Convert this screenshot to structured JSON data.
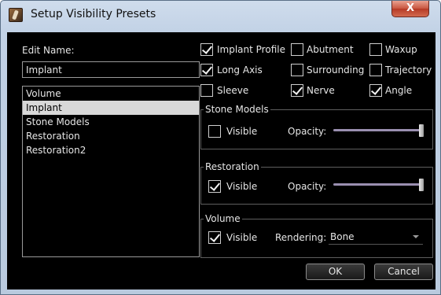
{
  "window": {
    "title": "Setup Visibility Presets",
    "close_label": "X"
  },
  "left": {
    "edit_name_label": "Edit Name:",
    "name_value": "Implant",
    "presets": [
      {
        "label": "Volume",
        "selected": false
      },
      {
        "label": "Implant",
        "selected": true
      },
      {
        "label": "Stone Models",
        "selected": false
      },
      {
        "label": "Restoration",
        "selected": false
      },
      {
        "label": "Restoration2",
        "selected": false
      }
    ]
  },
  "toggles": {
    "implant_profile": {
      "label": "Implant Profile",
      "checked": true
    },
    "abutment": {
      "label": "Abutment",
      "checked": false
    },
    "waxup": {
      "label": "Waxup",
      "checked": false
    },
    "long_axis": {
      "label": "Long Axis",
      "checked": true
    },
    "surrounding": {
      "label": "Surrounding",
      "checked": false
    },
    "trajectory": {
      "label": "Trajectory",
      "checked": false
    },
    "sleeve": {
      "label": "Sleeve",
      "checked": false
    },
    "nerve": {
      "label": "Nerve",
      "checked": true
    },
    "angle": {
      "label": "Angle",
      "checked": true
    }
  },
  "stone_models": {
    "title": "Stone Models",
    "visible_label": "Visible",
    "visible": false,
    "opacity_label": "Opacity:",
    "opacity": 1.0
  },
  "restoration": {
    "title": "Restoration",
    "visible_label": "Visible",
    "visible": true,
    "opacity_label": "Opacity:",
    "opacity": 1.0
  },
  "volume": {
    "title": "Volume",
    "visible_label": "Visible",
    "visible": true,
    "rendering_label": "Rendering:",
    "rendering_value": "Bone"
  },
  "buttons": {
    "ok": "OK",
    "cancel": "Cancel"
  }
}
